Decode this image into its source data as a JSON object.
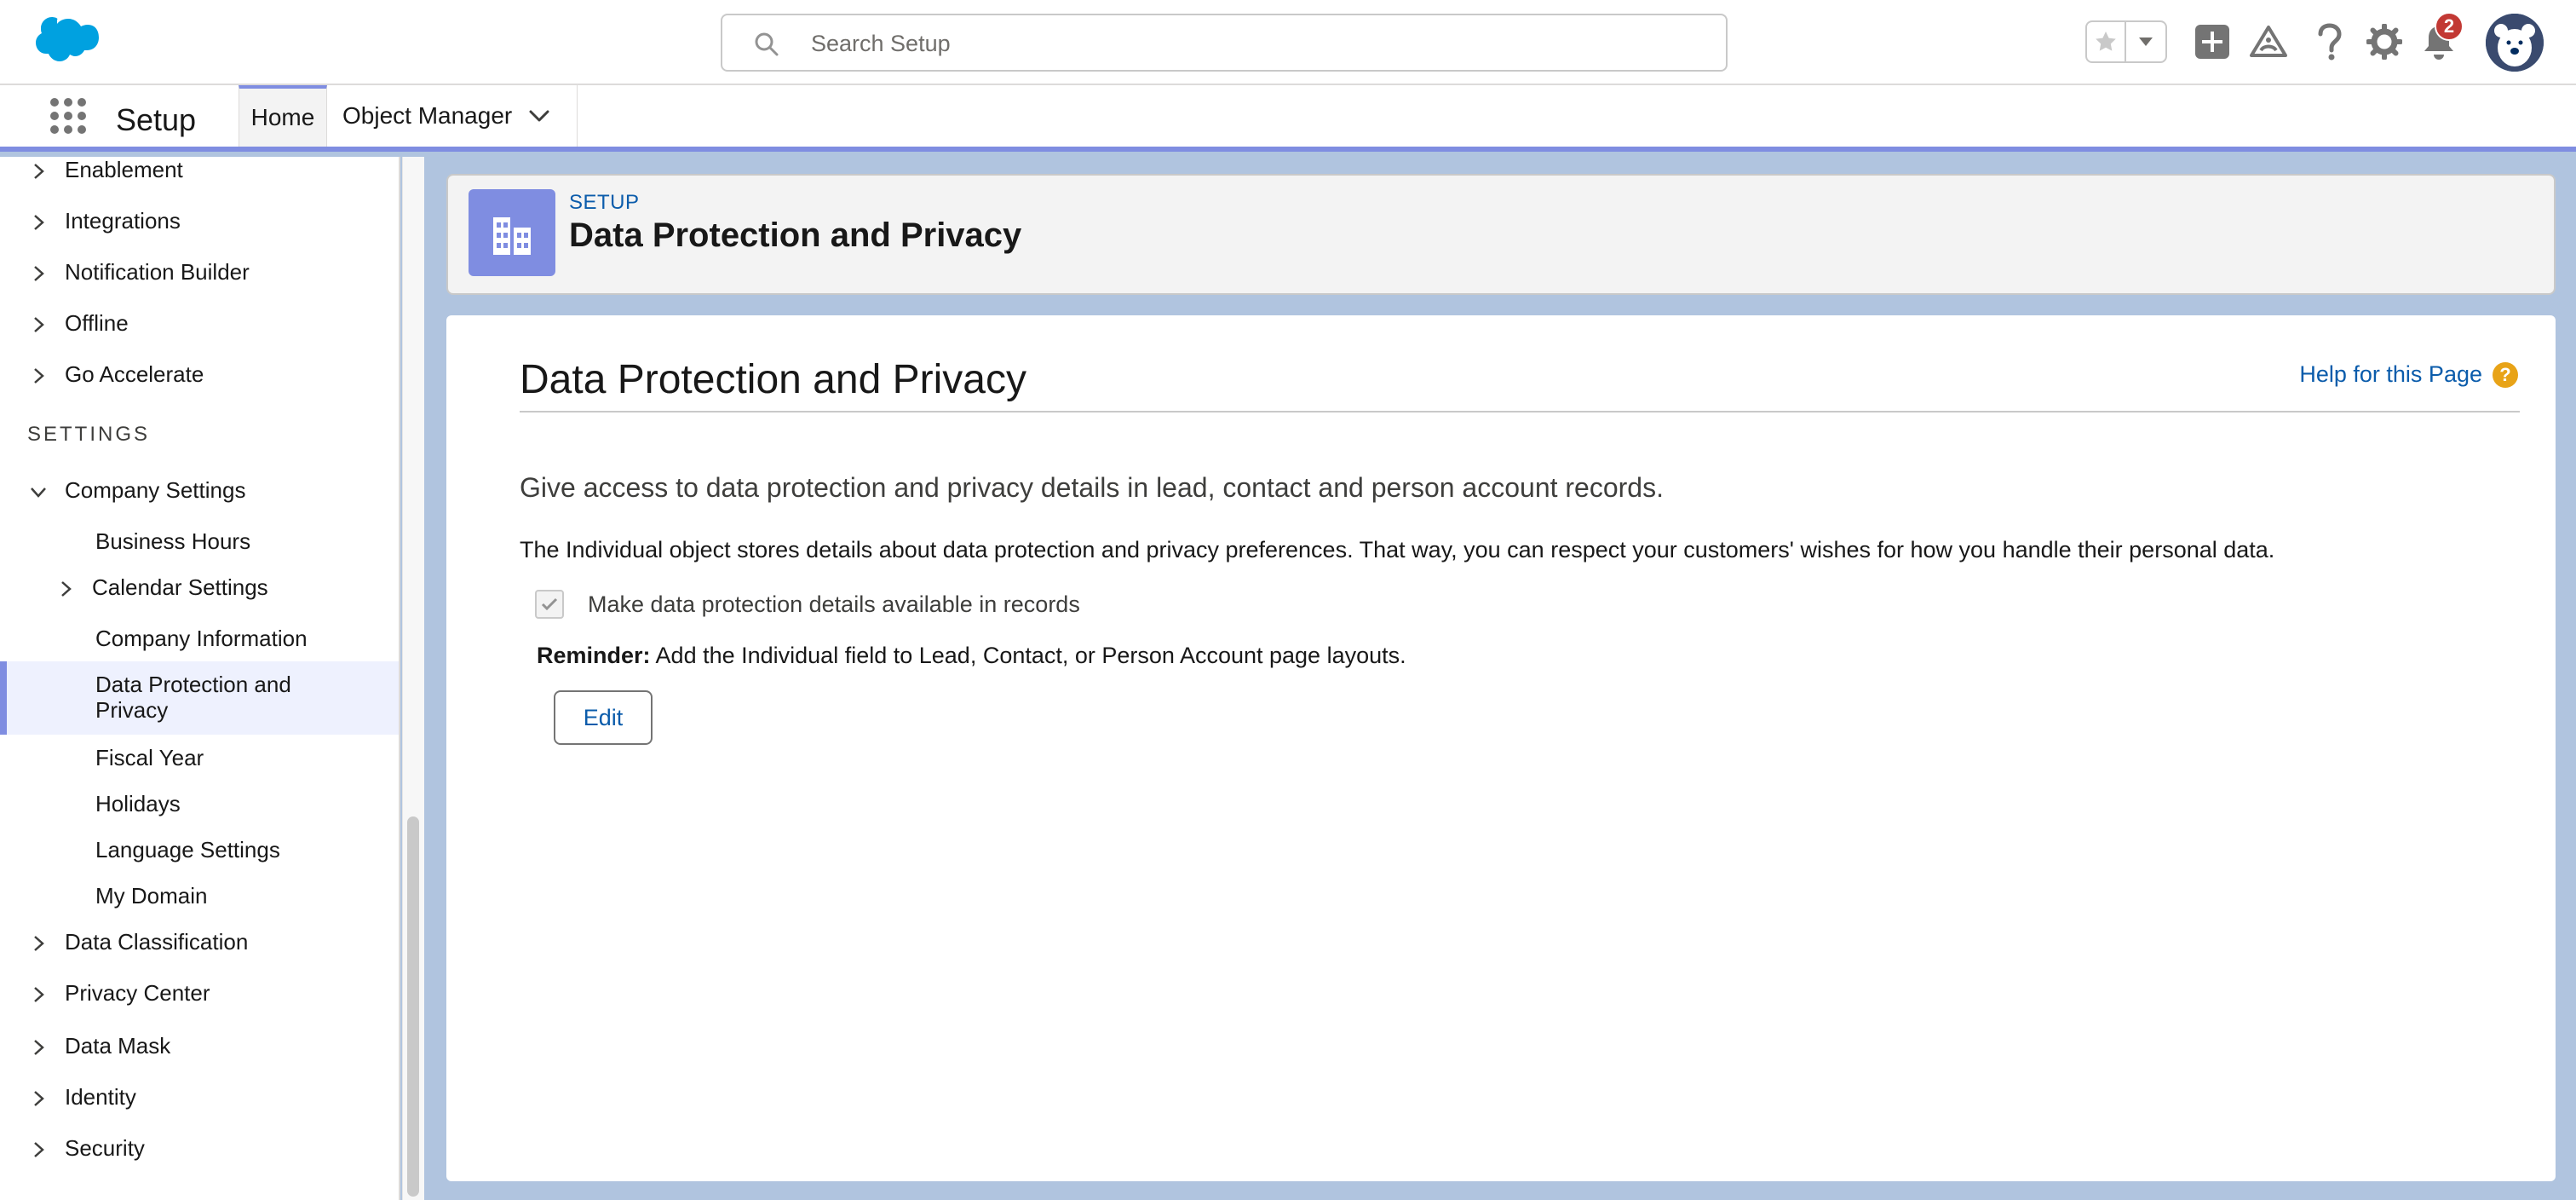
{
  "header": {
    "search_placeholder": "Search Setup",
    "notification_count": "2"
  },
  "context_bar": {
    "app_name": "Setup",
    "tabs": [
      {
        "label": "Home"
      },
      {
        "label": "Object Manager"
      }
    ]
  },
  "sidebar": {
    "items_top": [
      {
        "label": "Enablement"
      },
      {
        "label": "Integrations"
      },
      {
        "label": "Notification Builder"
      },
      {
        "label": "Offline"
      },
      {
        "label": "Go Accelerate"
      }
    ],
    "section_label": "SETTINGS",
    "company_settings": {
      "label": "Company Settings",
      "children": [
        {
          "label": "Business Hours"
        },
        {
          "label": "Calendar Settings"
        },
        {
          "label": "Company Information"
        },
        {
          "label": "Data Protection and Privacy"
        },
        {
          "label": "Fiscal Year"
        },
        {
          "label": "Holidays"
        },
        {
          "label": "Language Settings"
        },
        {
          "label": "My Domain"
        }
      ]
    },
    "items_bottom": [
      {
        "label": "Data Classification"
      },
      {
        "label": "Privacy Center"
      },
      {
        "label": "Data Mask"
      },
      {
        "label": "Identity"
      },
      {
        "label": "Security"
      }
    ]
  },
  "page_header": {
    "eyebrow": "SETUP",
    "title": "Data Protection and Privacy"
  },
  "content": {
    "title": "Data Protection and Privacy",
    "help_link": "Help for this Page",
    "lead": "Give access to data protection and privacy details in lead, contact and person account records.",
    "description": "The Individual object stores details about data protection and privacy preferences. That way, you can respect your customers' wishes for how you handle their personal data.",
    "checkbox_label": "Make data protection details available in records",
    "checkbox_checked": true,
    "reminder_label": "Reminder:",
    "reminder_text": " Add the Individual field to Lead, Contact, or Person Account page layouts.",
    "edit_button": "Edit"
  },
  "colors": {
    "brand_accent": "#7f8de1",
    "link": "#0b5cab",
    "background": "#b0c4df"
  }
}
